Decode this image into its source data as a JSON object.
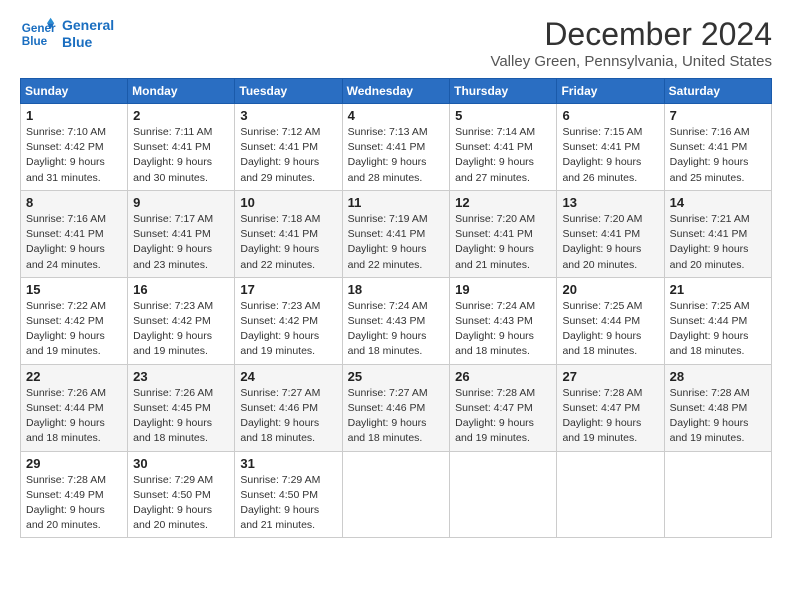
{
  "header": {
    "logo_line1": "General",
    "logo_line2": "Blue",
    "title": "December 2024",
    "location": "Valley Green, Pennsylvania, United States"
  },
  "calendar": {
    "days_of_week": [
      "Sunday",
      "Monday",
      "Tuesday",
      "Wednesday",
      "Thursday",
      "Friday",
      "Saturday"
    ],
    "weeks": [
      [
        {
          "day": "1",
          "sunrise": "7:10 AM",
          "sunset": "4:42 PM",
          "daylight": "9 hours and 31 minutes."
        },
        {
          "day": "2",
          "sunrise": "7:11 AM",
          "sunset": "4:41 PM",
          "daylight": "9 hours and 30 minutes."
        },
        {
          "day": "3",
          "sunrise": "7:12 AM",
          "sunset": "4:41 PM",
          "daylight": "9 hours and 29 minutes."
        },
        {
          "day": "4",
          "sunrise": "7:13 AM",
          "sunset": "4:41 PM",
          "daylight": "9 hours and 28 minutes."
        },
        {
          "day": "5",
          "sunrise": "7:14 AM",
          "sunset": "4:41 PM",
          "daylight": "9 hours and 27 minutes."
        },
        {
          "day": "6",
          "sunrise": "7:15 AM",
          "sunset": "4:41 PM",
          "daylight": "9 hours and 26 minutes."
        },
        {
          "day": "7",
          "sunrise": "7:16 AM",
          "sunset": "4:41 PM",
          "daylight": "9 hours and 25 minutes."
        }
      ],
      [
        {
          "day": "8",
          "sunrise": "7:16 AM",
          "sunset": "4:41 PM",
          "daylight": "9 hours and 24 minutes."
        },
        {
          "day": "9",
          "sunrise": "7:17 AM",
          "sunset": "4:41 PM",
          "daylight": "9 hours and 23 minutes."
        },
        {
          "day": "10",
          "sunrise": "7:18 AM",
          "sunset": "4:41 PM",
          "daylight": "9 hours and 22 minutes."
        },
        {
          "day": "11",
          "sunrise": "7:19 AM",
          "sunset": "4:41 PM",
          "daylight": "9 hours and 22 minutes."
        },
        {
          "day": "12",
          "sunrise": "7:20 AM",
          "sunset": "4:41 PM",
          "daylight": "9 hours and 21 minutes."
        },
        {
          "day": "13",
          "sunrise": "7:20 AM",
          "sunset": "4:41 PM",
          "daylight": "9 hours and 20 minutes."
        },
        {
          "day": "14",
          "sunrise": "7:21 AM",
          "sunset": "4:41 PM",
          "daylight": "9 hours and 20 minutes."
        }
      ],
      [
        {
          "day": "15",
          "sunrise": "7:22 AM",
          "sunset": "4:42 PM",
          "daylight": "9 hours and 19 minutes."
        },
        {
          "day": "16",
          "sunrise": "7:23 AM",
          "sunset": "4:42 PM",
          "daylight": "9 hours and 19 minutes."
        },
        {
          "day": "17",
          "sunrise": "7:23 AM",
          "sunset": "4:42 PM",
          "daylight": "9 hours and 19 minutes."
        },
        {
          "day": "18",
          "sunrise": "7:24 AM",
          "sunset": "4:43 PM",
          "daylight": "9 hours and 18 minutes."
        },
        {
          "day": "19",
          "sunrise": "7:24 AM",
          "sunset": "4:43 PM",
          "daylight": "9 hours and 18 minutes."
        },
        {
          "day": "20",
          "sunrise": "7:25 AM",
          "sunset": "4:44 PM",
          "daylight": "9 hours and 18 minutes."
        },
        {
          "day": "21",
          "sunrise": "7:25 AM",
          "sunset": "4:44 PM",
          "daylight": "9 hours and 18 minutes."
        }
      ],
      [
        {
          "day": "22",
          "sunrise": "7:26 AM",
          "sunset": "4:44 PM",
          "daylight": "9 hours and 18 minutes."
        },
        {
          "day": "23",
          "sunrise": "7:26 AM",
          "sunset": "4:45 PM",
          "daylight": "9 hours and 18 minutes."
        },
        {
          "day": "24",
          "sunrise": "7:27 AM",
          "sunset": "4:46 PM",
          "daylight": "9 hours and 18 minutes."
        },
        {
          "day": "25",
          "sunrise": "7:27 AM",
          "sunset": "4:46 PM",
          "daylight": "9 hours and 18 minutes."
        },
        {
          "day": "26",
          "sunrise": "7:28 AM",
          "sunset": "4:47 PM",
          "daylight": "9 hours and 19 minutes."
        },
        {
          "day": "27",
          "sunrise": "7:28 AM",
          "sunset": "4:47 PM",
          "daylight": "9 hours and 19 minutes."
        },
        {
          "day": "28",
          "sunrise": "7:28 AM",
          "sunset": "4:48 PM",
          "daylight": "9 hours and 19 minutes."
        }
      ],
      [
        {
          "day": "29",
          "sunrise": "7:28 AM",
          "sunset": "4:49 PM",
          "daylight": "9 hours and 20 minutes."
        },
        {
          "day": "30",
          "sunrise": "7:29 AM",
          "sunset": "4:50 PM",
          "daylight": "9 hours and 20 minutes."
        },
        {
          "day": "31",
          "sunrise": "7:29 AM",
          "sunset": "4:50 PM",
          "daylight": "9 hours and 21 minutes."
        },
        null,
        null,
        null,
        null
      ]
    ],
    "labels": {
      "sunrise": "Sunrise:",
      "sunset": "Sunset:",
      "daylight": "Daylight:"
    }
  }
}
